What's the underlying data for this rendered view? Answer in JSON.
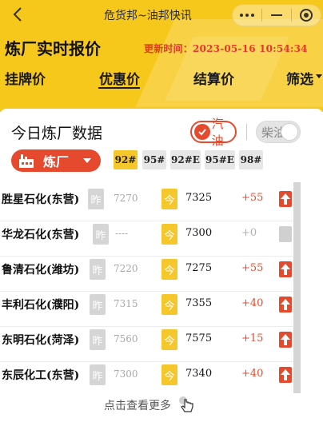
{
  "window": {
    "title": "危货邦~油邦快讯"
  },
  "header": {
    "page_title": "炼厂实时报价",
    "update_time": "更新时间：2023-05-16 10:54:34",
    "tabs": [
      {
        "label": "挂牌价",
        "active": false
      },
      {
        "label": "优惠价",
        "active": true
      },
      {
        "label": "结算价",
        "active": false
      },
      {
        "label": "筛选",
        "active": false
      }
    ]
  },
  "panel": {
    "title": "今日炼厂数据",
    "fuel_gasoline": "汽油",
    "fuel_diesel": "柴油",
    "refinery_button": "炼厂",
    "grades": [
      {
        "label": "92#",
        "active": true
      },
      {
        "label": "95#",
        "active": false
      },
      {
        "label": "92#E",
        "active": false
      },
      {
        "label": "95#E",
        "active": false
      },
      {
        "label": "98#",
        "active": false
      }
    ]
  },
  "labels": {
    "yesterday": "昨",
    "today": "今"
  },
  "rows": [
    {
      "name": "胜星石化(东营)",
      "yesterday": "7270",
      "today": "7325",
      "change": "+55",
      "trend": "up"
    },
    {
      "name": "华龙石化(东营)",
      "yesterday": "----",
      "today": "7300",
      "change": "+0",
      "trend": "flat"
    },
    {
      "name": "鲁清石化(潍坊)",
      "yesterday": "7220",
      "today": "7275",
      "change": "+55",
      "trend": "up"
    },
    {
      "name": "丰利石化(濮阳)",
      "yesterday": "7315",
      "today": "7355",
      "change": "+40",
      "trend": "up"
    },
    {
      "name": "东明石化(菏泽)",
      "yesterday": "7560",
      "today": "7575",
      "change": "+15",
      "trend": "up"
    },
    {
      "name": "东辰化工(东营)",
      "yesterday": "7300",
      "today": "7340",
      "change": "+40",
      "trend": "up"
    }
  ],
  "footer": {
    "more_label": "点击查看更多"
  },
  "colors": {
    "header_yellow": "#f7c81c",
    "accent_red": "#e64a2e",
    "today_yellow": "#f6c72a"
  }
}
